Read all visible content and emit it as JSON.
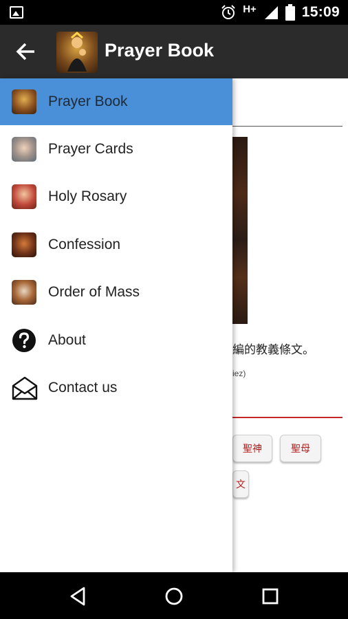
{
  "status_bar": {
    "time": "15:09",
    "network": "H+",
    "icons": [
      "image-icon",
      "alarm-icon",
      "signal-icon",
      "battery-icon"
    ]
  },
  "app_bar": {
    "title": "Prayer Book",
    "back_icon": "arrow-back-icon",
    "logo_icon": "madonna-icon"
  },
  "drawer": {
    "items": [
      {
        "label": "Prayer Book",
        "active": true
      },
      {
        "label": "Prayer Cards",
        "active": false
      },
      {
        "label": "Holy Rosary",
        "active": false
      },
      {
        "label": "Confession",
        "active": false
      },
      {
        "label": "Order of Mass",
        "active": false
      },
      {
        "label": "About",
        "active": false
      },
      {
        "label": "Contact us",
        "active": false
      }
    ],
    "active_color": "#4a90d9"
  },
  "content": {
    "paragraph": "編的教義條文。",
    "small_text": "iez)",
    "chips": [
      "聖神",
      "聖母",
      "文"
    ]
  },
  "nav_bar": {
    "icons": [
      "back-triangle-icon",
      "home-circle-icon",
      "recents-square-icon"
    ]
  }
}
